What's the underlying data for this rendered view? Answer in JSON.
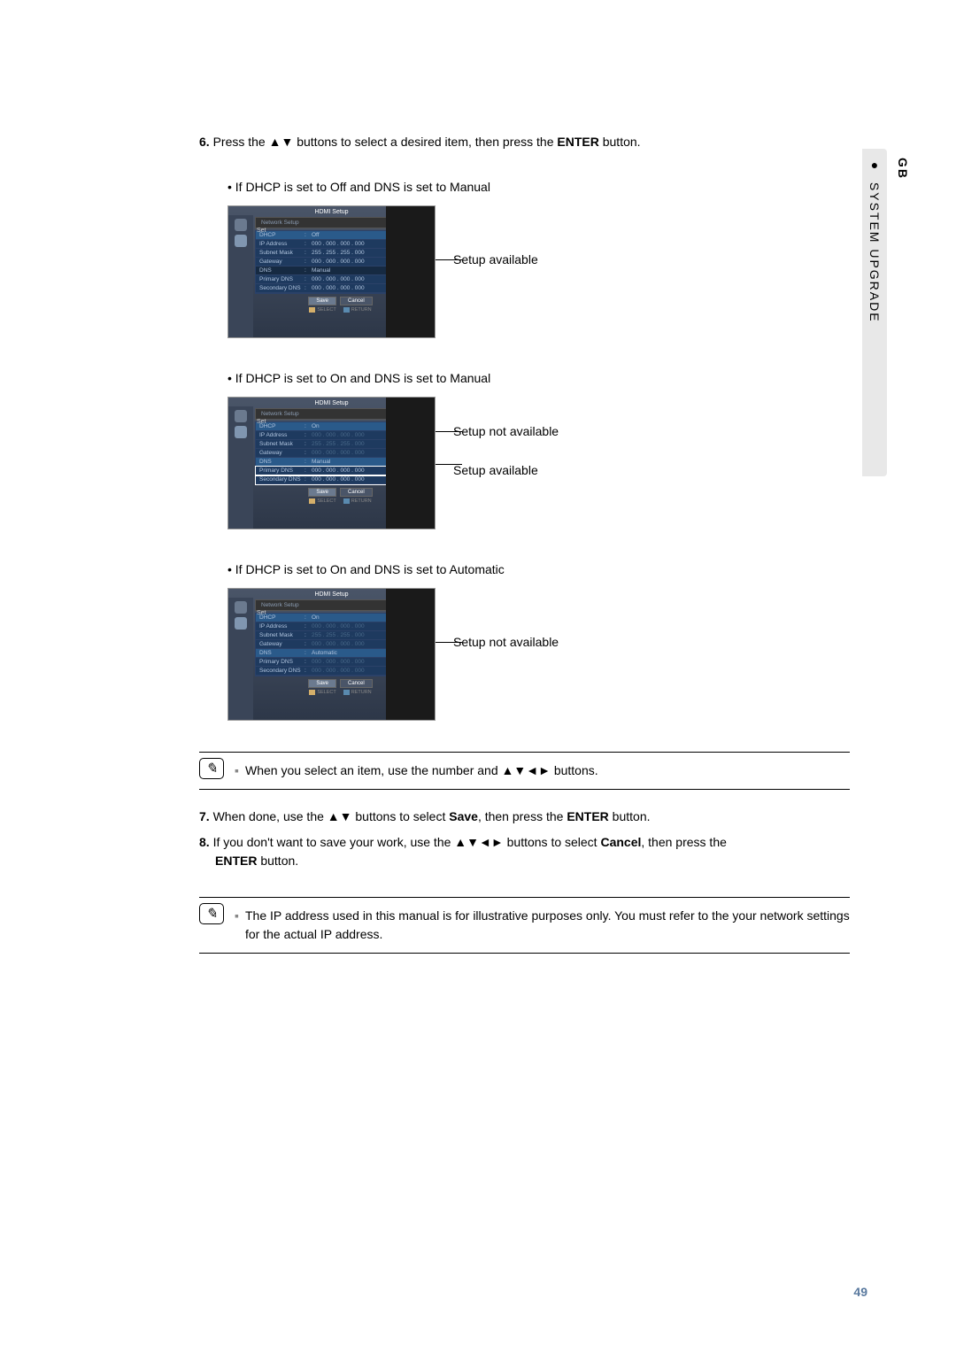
{
  "side_tab": {
    "gb": "GB",
    "bullet": "●",
    "section": "SYSTEM UPGRADE"
  },
  "step6": {
    "num": "6.",
    "prefix": "Press the ",
    "arrows": "▲▼",
    "middle": " buttons to select a desired item, then press the ",
    "enter": "ENTER",
    "suffix": " button."
  },
  "block1": {
    "bullet": "• If DHCP is set to Off and DNS is set to Manual",
    "callout1": "Setup available",
    "hdmi": "HDMI Setup",
    "net_header": "Network Setup",
    "set_label": "Set",
    "rows": {
      "dhcp": {
        "label": "DHCP",
        "val": "Off"
      },
      "ip": {
        "label": "IP Address",
        "val": "000 . 000 . 000 . 000"
      },
      "subnet": {
        "label": "Subnet Mask",
        "val": "255 . 255 . 255 . 000"
      },
      "gateway": {
        "label": "Gateway",
        "val": "000 . 000 . 000 . 000"
      },
      "dns": {
        "label": "DNS",
        "val": "Manual"
      },
      "pdns": {
        "label": "Primary DNS",
        "val": "000 . 000 . 000 . 000"
      },
      "sdns": {
        "label": "Secondary DNS",
        "val": "000 . 000 . 000 . 000"
      }
    },
    "save": "Save",
    "cancel": "Cancel",
    "select_hint": "SELECT",
    "return_hint": "RETURN"
  },
  "block2": {
    "bullet": "• If DHCP is set to On and DNS is set to Manual",
    "callout1": "Setup not available",
    "callout2": "Setup available",
    "rows": {
      "dhcp": {
        "label": "DHCP",
        "val": "On"
      },
      "ip": {
        "label": "IP Address",
        "val": "000 . 000 . 000 . 000"
      },
      "subnet": {
        "label": "Subnet Mask",
        "val": "255 . 255 . 255 . 000"
      },
      "gateway": {
        "label": "Gateway",
        "val": "000 . 000 . 000 . 000"
      },
      "dns": {
        "label": "DNS",
        "val": "Manual"
      },
      "pdns": {
        "label": "Primary DNS",
        "val": "000 . 000 . 000 . 000"
      },
      "sdns": {
        "label": "Secondary DNS",
        "val": "000 . 000 . 000 . 000"
      }
    }
  },
  "block3": {
    "bullet": "• If DHCP is set to On and DNS is set to Automatic",
    "callout1": "Setup not available",
    "rows": {
      "dhcp": {
        "label": "DHCP",
        "val": "On"
      },
      "ip": {
        "label": "IP Address",
        "val": "000 . 000 . 000 . 000"
      },
      "subnet": {
        "label": "Subnet Mask",
        "val": "255 . 255 . 255 . 000"
      },
      "gateway": {
        "label": "Gateway",
        "val": "000 . 000 . 000 . 000"
      },
      "dns": {
        "label": "DNS",
        "val": "Automatic"
      },
      "pdns": {
        "label": "Primary DNS",
        "val": "000 . 000 . 000 . 000"
      },
      "sdns": {
        "label": "Secondary DNS",
        "val": "000 . 000 . 000 . 000"
      }
    }
  },
  "note1": {
    "prefix": "When you select an item, use the number and ",
    "arrows": "▲▼◄►",
    "suffix": " buttons."
  },
  "step7": {
    "num": "7.",
    "prefix": "When done, use the ",
    "arrows": "▲▼",
    "mid1": " buttons to select ",
    "save": "Save",
    "mid2": ", then press the ",
    "enter": "ENTER",
    "suffix": " button."
  },
  "step8": {
    "num": "8.",
    "prefix": "If you don't want to save your work, use the ",
    "arrows": "▲▼◄►",
    "mid1": " buttons to select ",
    "cancel": "Cancel",
    "mid2": ", then press the ",
    "enter": "ENTER",
    "suffix": " button."
  },
  "note2": {
    "text": "The IP address used in this manual is for illustrative purposes only. You must refer to the your network settings for the actual IP address."
  },
  "page_num": "49",
  "note_sym": "▪"
}
